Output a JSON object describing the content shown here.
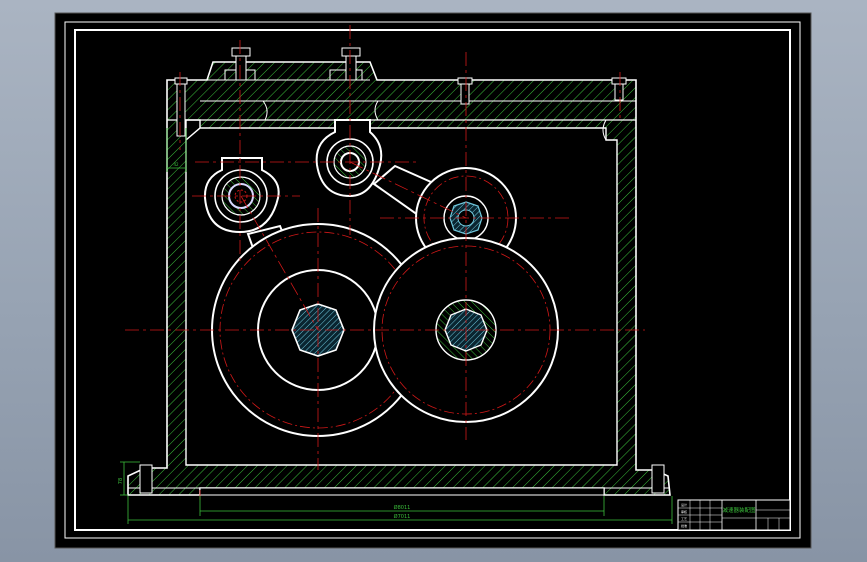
{
  "app": {
    "background_colors": {
      "top": "#aab4c2",
      "bottom": "#8894a5"
    }
  },
  "drawing": {
    "colors": {
      "sheet": "#000000",
      "frame": "#ffffff",
      "centerline": "#d01818",
      "hatch": "#3bbf3b",
      "dimension": "#3bbf3b",
      "gear_outline": "#ffffff",
      "bore_fill": "#6fc7dc",
      "bearing_fill": "#d9d9ff",
      "title_block_name": "#3bbf3b"
    },
    "dimensions": {
      "inner_length": "Ø8011",
      "overall_length": "Ø7011",
      "left_height": "78",
      "flange_offset": "42"
    },
    "title_block": {
      "drawing_name": "减速器装配图",
      "row_labels": [
        "设计",
        "审核",
        "工艺",
        "批准"
      ]
    },
    "icons": {
      "gear": "gear-icon",
      "bearing": "bearing-icon",
      "bolt": "bolt-icon"
    }
  }
}
